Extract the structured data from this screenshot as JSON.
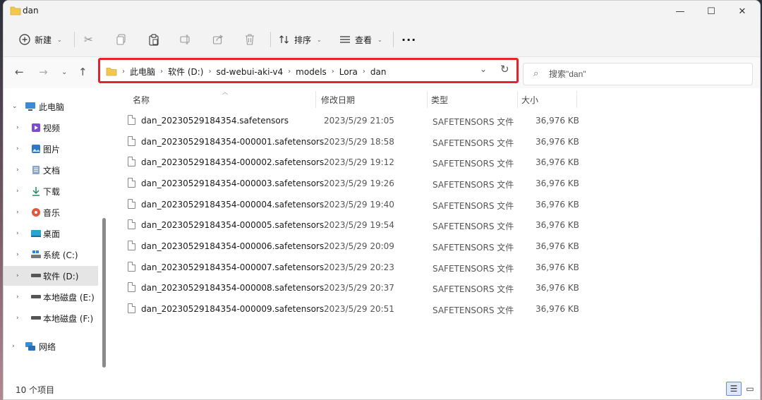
{
  "window": {
    "title": "dan"
  },
  "titlebar": {
    "minimize_glyph": "—",
    "maximize_glyph": "☐",
    "close_glyph": "✕"
  },
  "toolbar": {
    "new_label": "新建",
    "sort_label": "排序",
    "view_label": "查看",
    "more_glyph": "···"
  },
  "address": {
    "crumbs": [
      "此电脑",
      "软件 (D:)",
      "sd-webui-aki-v4",
      "models",
      "Lora",
      "dan"
    ]
  },
  "search": {
    "placeholder": "搜索\"dan\""
  },
  "sidebar": {
    "items": [
      {
        "label": "此电脑",
        "icon": "computer-icon",
        "expanded": true
      },
      {
        "label": "视频",
        "icon": "video-folder-icon"
      },
      {
        "label": "图片",
        "icon": "pictures-folder-icon"
      },
      {
        "label": "文档",
        "icon": "documents-folder-icon"
      },
      {
        "label": "下载",
        "icon": "download-icon"
      },
      {
        "label": "音乐",
        "icon": "music-icon"
      },
      {
        "label": "桌面",
        "icon": "desktop-icon"
      },
      {
        "label": "系统 (C:)",
        "icon": "windows-drive-icon"
      },
      {
        "label": "软件 (D:)",
        "icon": "drive-icon",
        "selected": true
      },
      {
        "label": "本地磁盘 (E:)",
        "icon": "drive-icon"
      },
      {
        "label": "本地磁盘 (F:)",
        "icon": "drive-icon"
      },
      {
        "label": "网络",
        "icon": "network-icon"
      }
    ]
  },
  "columns": {
    "name": "名称",
    "modified": "修改日期",
    "type": "类型",
    "size": "大小"
  },
  "files": [
    {
      "name": "dan_20230529184354.safetensors",
      "modified": "2023/5/29 21:05",
      "type": "SAFETENSORS 文件",
      "size": "36,976 KB"
    },
    {
      "name": "dan_20230529184354-000001.safetensors",
      "modified": "2023/5/29 18:58",
      "type": "SAFETENSORS 文件",
      "size": "36,976 KB"
    },
    {
      "name": "dan_20230529184354-000002.safetensors",
      "modified": "2023/5/29 19:12",
      "type": "SAFETENSORS 文件",
      "size": "36,976 KB"
    },
    {
      "name": "dan_20230529184354-000003.safetensors",
      "modified": "2023/5/29 19:26",
      "type": "SAFETENSORS 文件",
      "size": "36,976 KB"
    },
    {
      "name": "dan_20230529184354-000004.safetensors",
      "modified": "2023/5/29 19:40",
      "type": "SAFETENSORS 文件",
      "size": "36,976 KB"
    },
    {
      "name": "dan_20230529184354-000005.safetensors",
      "modified": "2023/5/29 19:54",
      "type": "SAFETENSORS 文件",
      "size": "36,976 KB"
    },
    {
      "name": "dan_20230529184354-000006.safetensors",
      "modified": "2023/5/29 20:09",
      "type": "SAFETENSORS 文件",
      "size": "36,976 KB"
    },
    {
      "name": "dan_20230529184354-000007.safetensors",
      "modified": "2023/5/29 20:23",
      "type": "SAFETENSORS 文件",
      "size": "36,976 KB"
    },
    {
      "name": "dan_20230529184354-000008.safetensors",
      "modified": "2023/5/29 20:37",
      "type": "SAFETENSORS 文件",
      "size": "36,976 KB"
    },
    {
      "name": "dan_20230529184354-000009.safetensors",
      "modified": "2023/5/29 20:51",
      "type": "SAFETENSORS 文件",
      "size": "36,976 KB"
    }
  ],
  "status": {
    "item_count": "10 个项目"
  },
  "colors": {
    "highlight_border": "#e3242b",
    "folder": "#f2c94c",
    "selected_bg": "#e5e5e5"
  }
}
